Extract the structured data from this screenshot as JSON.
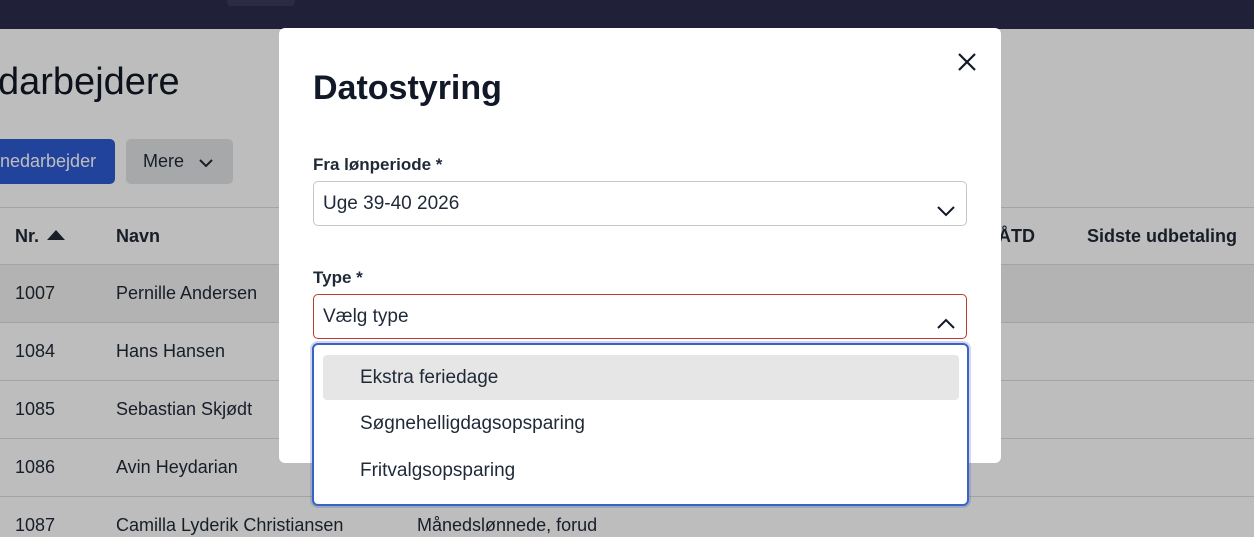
{
  "page": {
    "title": "darbejdere",
    "primary_button": "nedarbejder",
    "more_button": "Mere"
  },
  "table": {
    "headers": {
      "nr": "Nr.",
      "navn": "Navn",
      "atd": "t ÅTD",
      "sidste": "Sidste udbetaling"
    },
    "rows": [
      {
        "nr": "1007",
        "navn": "Pernille Andersen",
        "type": ""
      },
      {
        "nr": "1084",
        "navn": "Hans Hansen",
        "type": ""
      },
      {
        "nr": "1085",
        "navn": "Sebastian Skjødt",
        "type": ""
      },
      {
        "nr": "1086",
        "navn": "Avin Heydarian",
        "type": ""
      },
      {
        "nr": "1087",
        "navn": "Camilla Lyderik Christiansen",
        "type": "Månedslønnede, forud"
      }
    ]
  },
  "modal": {
    "title": "Datostyring",
    "period_label": "Fra lønperiode *",
    "period_value": "Uge 39-40 2026",
    "type_label": "Type *",
    "type_placeholder": "Vælg type",
    "options": [
      "Ekstra feriedage",
      "Søgnehelligdagsopsparing",
      "Fritvalgsopsparing"
    ]
  },
  "colors": {
    "topbar": "#2c2c4d",
    "primary": "#2f5bd3",
    "invalid_border": "#c0392b",
    "focus_border": "#3b63c4"
  }
}
